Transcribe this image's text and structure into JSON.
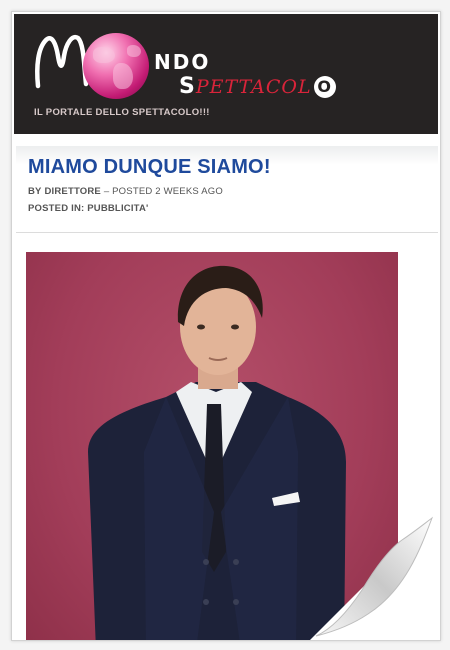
{
  "site": {
    "logo_parts": [
      "M",
      "NDO",
      "S",
      "PETTACOL",
      "O"
    ],
    "tagline": "IL PORTALE DELLO SPETTACOLO!!!"
  },
  "post": {
    "title": "MIAMO DUNQUE SIAMO!",
    "by_prefix": "BY",
    "author": "DIRETTORE",
    "posted": "– POSTED 2 WEEKS AGO",
    "posted_in_label": "POSTED IN:",
    "category": "PUBBLICITA'"
  },
  "colors": {
    "header_bg": "#262323",
    "title_blue": "#1f4a9c",
    "photo_bg": "#a23d59",
    "logo_red": "#d9243a"
  },
  "photo": {
    "subject": "man in navy double-breasted suit"
  }
}
